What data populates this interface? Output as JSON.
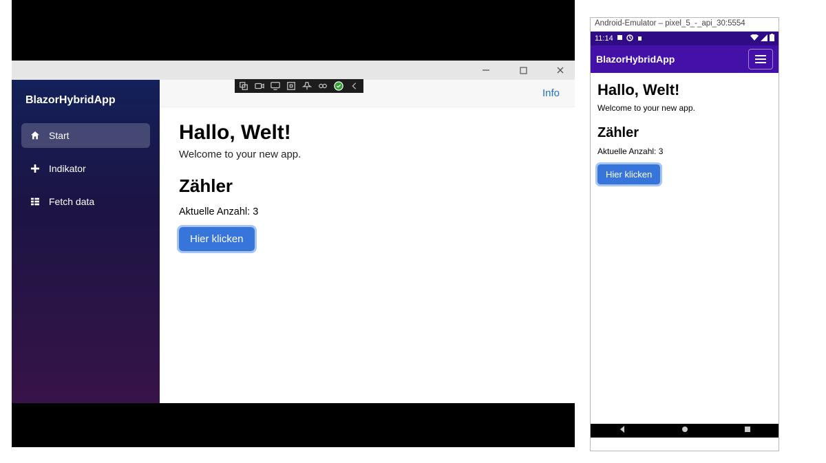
{
  "desktop": {
    "brand": "BlazorHybridApp",
    "info_link": "Info",
    "nav": [
      {
        "label": "Start"
      },
      {
        "label": "Indikator"
      },
      {
        "label": "Fetch data"
      }
    ],
    "content": {
      "heading": "Hallo, Welt!",
      "subheading": "Welcome to your new app.",
      "counter_heading": "Zähler",
      "count_label": "Aktuelle Anzahl: 3",
      "button_label": "Hier klicken"
    }
  },
  "emulator": {
    "window_title": "Android-Emulator – pixel_5_-_api_30:5554",
    "status_time": "11:14",
    "appbar_brand": "BlazorHybridApp",
    "content": {
      "heading": "Hallo, Welt!",
      "subheading": "Welcome to your new app.",
      "counter_heading": "Zähler",
      "count_label": "Aktuelle Anzahl: 3",
      "button_label": "Hier klicken"
    }
  }
}
